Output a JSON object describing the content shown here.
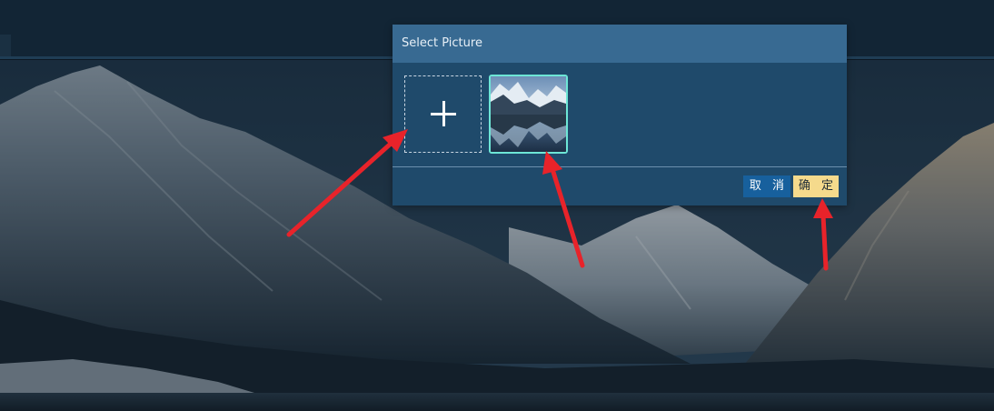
{
  "dialog": {
    "title": "Select Picture",
    "cancel_label": "取 消",
    "confirm_label": "确 定"
  },
  "colors": {
    "dialog_header": "#386a92",
    "dialog_body": "#1f4a6b",
    "selected_border": "#6de6d6",
    "cancel_button": "#17609d",
    "confirm_button": "#f5da8c",
    "arrow": "#e8232a"
  },
  "icons": {
    "add": "plus-icon"
  }
}
